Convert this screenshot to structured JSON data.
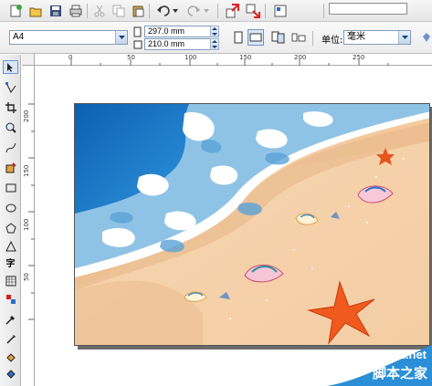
{
  "toolbar": {
    "buttons": [
      "new-icon",
      "open-icon",
      "save-icon",
      "print-icon",
      "cut-icon",
      "copy-icon",
      "paste-icon",
      "undo-icon",
      "redo-icon",
      "import-icon",
      "export-icon",
      "application-launcher-icon"
    ]
  },
  "property_bar": {
    "paper_type": "A4",
    "width_value": "297.0 mm",
    "height_value": "210.0 mm",
    "unit_label": "单位:",
    "unit_value": "毫米"
  },
  "toolbox": {
    "tools": [
      "pick-tool-icon",
      "shape-tool-icon",
      "crop-tool-icon",
      "zoom-tool-icon",
      "freehand-tool-icon",
      "smart-fill-icon",
      "rectangle-tool-icon",
      "ellipse-tool-icon",
      "polygon-tool-icon",
      "basic-shapes-icon",
      "text-tool-icon",
      "table-tool-icon",
      "interactive-blend-icon",
      "eyedropper-icon",
      "outline-tool-icon",
      "fill-tool-icon",
      "interactive-fill-icon"
    ],
    "text_tool_glyph": "字"
  },
  "ruler_h": {
    "labels": [
      "0",
      "50",
      "100",
      "150",
      "200",
      "250"
    ]
  },
  "ruler_v": {
    "labels": [
      "200",
      "150",
      "100",
      "50"
    ]
  },
  "watermark": {
    "site": "jb51.net",
    "name": "脚本之家"
  },
  "colors": {
    "sea_deep": "#0f6fc2",
    "sea_light": "#79b4dd",
    "foam": "#ffffff",
    "sand": "#f3c89c",
    "starfish": "#f05a1e"
  }
}
